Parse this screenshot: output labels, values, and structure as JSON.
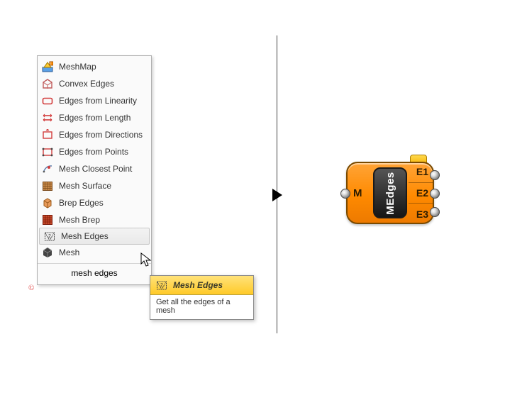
{
  "menu": {
    "items": [
      {
        "label": "MeshMap",
        "icon": "meshmap"
      },
      {
        "label": "Convex Edges",
        "icon": "convex"
      },
      {
        "label": "Edges from Linearity",
        "icon": "linearity"
      },
      {
        "label": "Edges from Length",
        "icon": "length"
      },
      {
        "label": "Edges from Directions",
        "icon": "directions"
      },
      {
        "label": "Edges from Points",
        "icon": "points"
      },
      {
        "label": "Mesh Closest Point",
        "icon": "closest"
      },
      {
        "label": "Mesh Surface",
        "icon": "surface"
      },
      {
        "label": "Brep Edges",
        "icon": "brepedges"
      },
      {
        "label": "Mesh Brep",
        "icon": "meshbrep"
      },
      {
        "label": "Mesh Edges",
        "icon": "meshedges"
      },
      {
        "label": "Mesh",
        "icon": "mesh"
      }
    ],
    "selected_index": 10,
    "search_value": "mesh edges"
  },
  "tooltip": {
    "title": "Mesh Edges",
    "body": "Get all the edges of a mesh"
  },
  "copyright_glyph": "©",
  "component": {
    "title": "MEdges",
    "input": "M",
    "outputs": [
      "E1",
      "E2",
      "E3"
    ]
  }
}
